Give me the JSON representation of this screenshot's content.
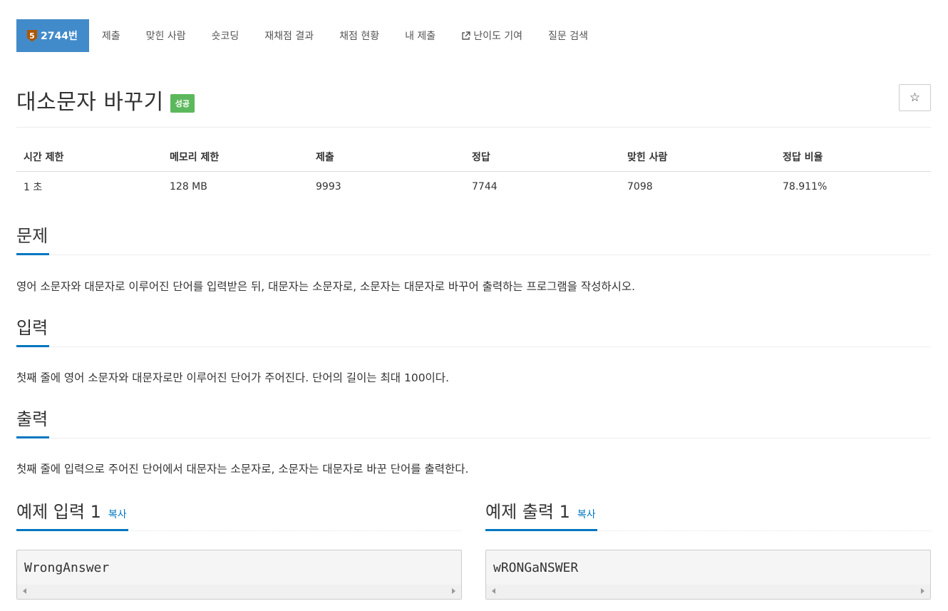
{
  "nav": {
    "problem_number": "2744번",
    "tier_level": "5",
    "items": [
      {
        "label": "제출"
      },
      {
        "label": "맞힌 사람"
      },
      {
        "label": "숏코딩"
      },
      {
        "label": "재채점 결과"
      },
      {
        "label": "채점 현황"
      },
      {
        "label": "내 제출"
      },
      {
        "label": "난이도 기여"
      },
      {
        "label": "질문 검색"
      }
    ]
  },
  "problem": {
    "title": "대소문자 바꾸기",
    "status_badge": "성공",
    "star_symbol": "☆"
  },
  "info_table": {
    "headers": [
      "시간 제한",
      "메모리 제한",
      "제출",
      "정답",
      "맞힌 사람",
      "정답 비율"
    ],
    "values": [
      "1 초",
      "128 MB",
      "9993",
      "7744",
      "7098",
      "78.911%"
    ]
  },
  "sections": {
    "description": {
      "title": "문제",
      "text": "영어 소문자와 대문자로 이루어진 단어를 입력받은 뒤, 대문자는 소문자로, 소문자는 대문자로 바꾸어 출력하는 프로그램을 작성하시오."
    },
    "input": {
      "title": "입력",
      "text": "첫째 줄에 영어 소문자와 대문자로만 이루어진 단어가 주어진다. 단어의 길이는 최대 100이다."
    },
    "output": {
      "title": "출력",
      "text": "첫째 줄에 입력으로 주어진 단어에서 대문자는 소문자로, 소문자는 대문자로 바꾼 단어를 출력한다."
    }
  },
  "samples": {
    "input": {
      "title": "예제 입력 1",
      "copy_label": "복사",
      "content": "WrongAnswer"
    },
    "output": {
      "title": "예제 출력 1",
      "copy_label": "복사",
      "content": "wRONGaNSWER"
    }
  },
  "colors": {
    "nav_active": "#428bca",
    "tier_bronze": "#ad5600",
    "badge_success": "#5cb85c",
    "section_underline": "#0076c0"
  }
}
